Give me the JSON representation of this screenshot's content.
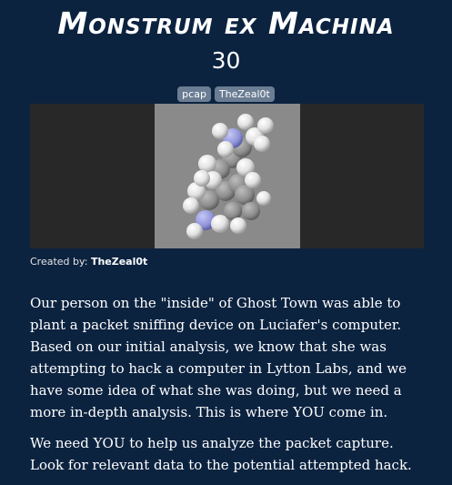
{
  "challenge": {
    "title": "Monstrum ex Machina",
    "points": "30",
    "tags": [
      "pcap",
      "TheZeal0t"
    ],
    "created_by_label": "Created by:",
    "author": "TheZeal0t",
    "description": [
      "Our person on the \"inside\" of Ghost Town was able to plant a packet sniffing device on Luciafer's computer. Based on our initial analysis, we know that she was attempting to hack a computer in Lytton Labs, and we have some idea of what she was doing, but we need a more in-depth analysis. This is where YOU come in.",
      "We need YOU to help us analyze the packet capture. Look for relevant data to the potential attempted hack."
    ]
  },
  "colors": {
    "background": "#0c2340",
    "tag_background": "#6b7d93",
    "image_frame": "#282828",
    "image_background": "#8a8a8a"
  }
}
